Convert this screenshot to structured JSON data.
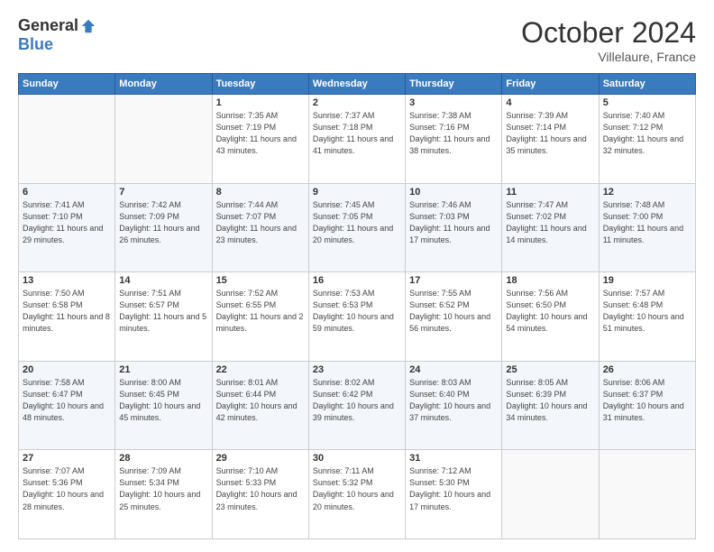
{
  "header": {
    "logo_general": "General",
    "logo_blue": "Blue",
    "month": "October 2024",
    "location": "Villelaure, France"
  },
  "columns": [
    "Sunday",
    "Monday",
    "Tuesday",
    "Wednesday",
    "Thursday",
    "Friday",
    "Saturday"
  ],
  "weeks": [
    [
      {
        "day": "",
        "info": ""
      },
      {
        "day": "",
        "info": ""
      },
      {
        "day": "1",
        "info": "Sunrise: 7:35 AM\nSunset: 7:19 PM\nDaylight: 11 hours\nand 43 minutes."
      },
      {
        "day": "2",
        "info": "Sunrise: 7:37 AM\nSunset: 7:18 PM\nDaylight: 11 hours\nand 41 minutes."
      },
      {
        "day": "3",
        "info": "Sunrise: 7:38 AM\nSunset: 7:16 PM\nDaylight: 11 hours\nand 38 minutes."
      },
      {
        "day": "4",
        "info": "Sunrise: 7:39 AM\nSunset: 7:14 PM\nDaylight: 11 hours\nand 35 minutes."
      },
      {
        "day": "5",
        "info": "Sunrise: 7:40 AM\nSunset: 7:12 PM\nDaylight: 11 hours\nand 32 minutes."
      }
    ],
    [
      {
        "day": "6",
        "info": "Sunrise: 7:41 AM\nSunset: 7:10 PM\nDaylight: 11 hours\nand 29 minutes."
      },
      {
        "day": "7",
        "info": "Sunrise: 7:42 AM\nSunset: 7:09 PM\nDaylight: 11 hours\nand 26 minutes."
      },
      {
        "day": "8",
        "info": "Sunrise: 7:44 AM\nSunset: 7:07 PM\nDaylight: 11 hours\nand 23 minutes."
      },
      {
        "day": "9",
        "info": "Sunrise: 7:45 AM\nSunset: 7:05 PM\nDaylight: 11 hours\nand 20 minutes."
      },
      {
        "day": "10",
        "info": "Sunrise: 7:46 AM\nSunset: 7:03 PM\nDaylight: 11 hours\nand 17 minutes."
      },
      {
        "day": "11",
        "info": "Sunrise: 7:47 AM\nSunset: 7:02 PM\nDaylight: 11 hours\nand 14 minutes."
      },
      {
        "day": "12",
        "info": "Sunrise: 7:48 AM\nSunset: 7:00 PM\nDaylight: 11 hours\nand 11 minutes."
      }
    ],
    [
      {
        "day": "13",
        "info": "Sunrise: 7:50 AM\nSunset: 6:58 PM\nDaylight: 11 hours\nand 8 minutes."
      },
      {
        "day": "14",
        "info": "Sunrise: 7:51 AM\nSunset: 6:57 PM\nDaylight: 11 hours\nand 5 minutes."
      },
      {
        "day": "15",
        "info": "Sunrise: 7:52 AM\nSunset: 6:55 PM\nDaylight: 11 hours\nand 2 minutes."
      },
      {
        "day": "16",
        "info": "Sunrise: 7:53 AM\nSunset: 6:53 PM\nDaylight: 10 hours\nand 59 minutes."
      },
      {
        "day": "17",
        "info": "Sunrise: 7:55 AM\nSunset: 6:52 PM\nDaylight: 10 hours\nand 56 minutes."
      },
      {
        "day": "18",
        "info": "Sunrise: 7:56 AM\nSunset: 6:50 PM\nDaylight: 10 hours\nand 54 minutes."
      },
      {
        "day": "19",
        "info": "Sunrise: 7:57 AM\nSunset: 6:48 PM\nDaylight: 10 hours\nand 51 minutes."
      }
    ],
    [
      {
        "day": "20",
        "info": "Sunrise: 7:58 AM\nSunset: 6:47 PM\nDaylight: 10 hours\nand 48 minutes."
      },
      {
        "day": "21",
        "info": "Sunrise: 8:00 AM\nSunset: 6:45 PM\nDaylight: 10 hours\nand 45 minutes."
      },
      {
        "day": "22",
        "info": "Sunrise: 8:01 AM\nSunset: 6:44 PM\nDaylight: 10 hours\nand 42 minutes."
      },
      {
        "day": "23",
        "info": "Sunrise: 8:02 AM\nSunset: 6:42 PM\nDaylight: 10 hours\nand 39 minutes."
      },
      {
        "day": "24",
        "info": "Sunrise: 8:03 AM\nSunset: 6:40 PM\nDaylight: 10 hours\nand 37 minutes."
      },
      {
        "day": "25",
        "info": "Sunrise: 8:05 AM\nSunset: 6:39 PM\nDaylight: 10 hours\nand 34 minutes."
      },
      {
        "day": "26",
        "info": "Sunrise: 8:06 AM\nSunset: 6:37 PM\nDaylight: 10 hours\nand 31 minutes."
      }
    ],
    [
      {
        "day": "27",
        "info": "Sunrise: 7:07 AM\nSunset: 5:36 PM\nDaylight: 10 hours\nand 28 minutes."
      },
      {
        "day": "28",
        "info": "Sunrise: 7:09 AM\nSunset: 5:34 PM\nDaylight: 10 hours\nand 25 minutes."
      },
      {
        "day": "29",
        "info": "Sunrise: 7:10 AM\nSunset: 5:33 PM\nDaylight: 10 hours\nand 23 minutes."
      },
      {
        "day": "30",
        "info": "Sunrise: 7:11 AM\nSunset: 5:32 PM\nDaylight: 10 hours\nand 20 minutes."
      },
      {
        "day": "31",
        "info": "Sunrise: 7:12 AM\nSunset: 5:30 PM\nDaylight: 10 hours\nand 17 minutes."
      },
      {
        "day": "",
        "info": ""
      },
      {
        "day": "",
        "info": ""
      }
    ]
  ]
}
